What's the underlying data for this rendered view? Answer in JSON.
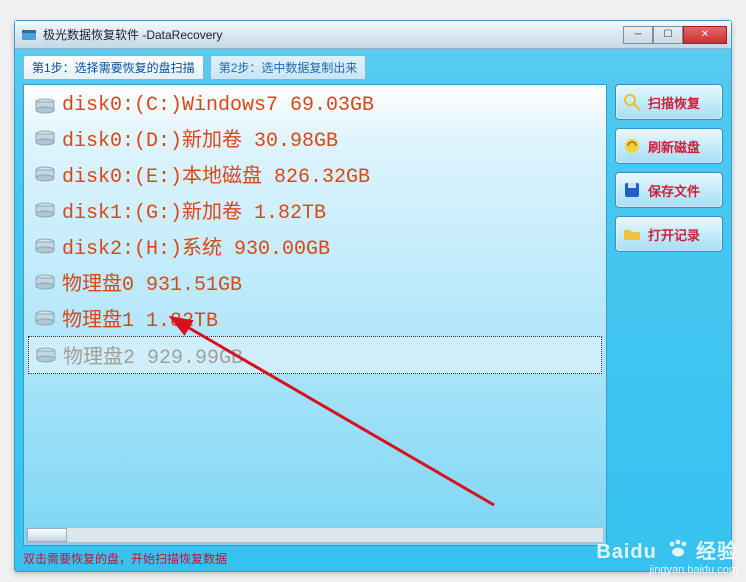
{
  "window": {
    "title": "极光数据恢复软件 -DataRecovery"
  },
  "tabs": {
    "step1": "第1步：选择需要恢复的盘扫描",
    "step2": "第2步：选中数据复制出来"
  },
  "disks": [
    {
      "icon": "disk",
      "label": "disk0:(C:)Windows7 69.03GB",
      "selected": false
    },
    {
      "icon": "disk",
      "label": "disk0:(D:)新加卷 30.98GB",
      "selected": false
    },
    {
      "icon": "disk",
      "label": "disk0:(E:)本地磁盘 826.32GB",
      "selected": false
    },
    {
      "icon": "disk",
      "label": "disk1:(G:)新加卷 1.82TB",
      "selected": false
    },
    {
      "icon": "disk",
      "label": "disk2:(H:)系统 930.00GB",
      "selected": false
    },
    {
      "icon": "phys",
      "label": "物理盘0 931.51GB",
      "selected": false
    },
    {
      "icon": "phys",
      "label": "物理盘1 1.82TB",
      "selected": false
    },
    {
      "icon": "phys",
      "label": "物理盘2 929.99GB",
      "selected": true
    }
  ],
  "side_buttons": {
    "scan_recover": "扫描恢复",
    "refresh_disk": "刷新磁盘",
    "save_file": "保存文件",
    "open_record": "打开记录"
  },
  "status": "双击需要恢复的盘，开始扫描恢复数据",
  "watermark": {
    "brand": "Baidu",
    "suffix": "经验",
    "url": "jingyan.baidu.com"
  },
  "colors": {
    "accent_text": "#d84818",
    "status": "#c81038",
    "side_label": "#d0203a"
  }
}
